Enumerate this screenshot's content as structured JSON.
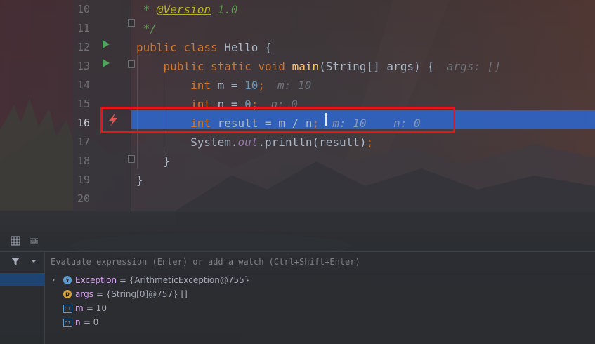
{
  "editor": {
    "lines": [
      {
        "num": "10",
        "parts": [
          {
            "t": " * ",
            "c": "cm"
          },
          {
            "t": "@Version",
            "c": "ann"
          },
          {
            "t": " 1.0",
            "c": "cm"
          }
        ]
      },
      {
        "num": "11",
        "parts": [
          {
            "t": " */",
            "c": "cm"
          }
        ]
      },
      {
        "num": "12",
        "parts": [
          {
            "t": "public class ",
            "c": "kw"
          },
          {
            "t": "Hello {",
            "c": ""
          }
        ]
      },
      {
        "num": "13",
        "parts": [
          {
            "t": "    public static void ",
            "c": "kw"
          },
          {
            "t": "main",
            "c": "fn"
          },
          {
            "t": "(String[] args) {",
            "c": ""
          },
          {
            "t": "args: []",
            "c": "hint"
          }
        ]
      },
      {
        "num": "14",
        "parts": [
          {
            "t": "        int ",
            "c": "kw"
          },
          {
            "t": "m = ",
            "c": ""
          },
          {
            "t": "10",
            "c": "num"
          },
          {
            "t": ";",
            "c": "kw"
          },
          {
            "t": "m: 10",
            "c": "hint"
          }
        ]
      },
      {
        "num": "15",
        "parts": [
          {
            "t": "        int ",
            "c": "kw"
          },
          {
            "t": "n = ",
            "c": ""
          },
          {
            "t": "0",
            "c": "num"
          },
          {
            "t": ";",
            "c": "kw"
          },
          {
            "t": "n: 0",
            "c": "hint"
          }
        ]
      },
      {
        "num": "16",
        "parts": [
          {
            "t": "        int ",
            "c": "kw"
          },
          {
            "t": "result = m / n",
            "c": ""
          },
          {
            "t": ";",
            "c": "kw"
          },
          {
            "t": "  m: 10    n: 0",
            "c": "hint2"
          }
        ]
      },
      {
        "num": "17",
        "parts": [
          {
            "t": "        System.",
            "c": ""
          },
          {
            "t": "out",
            "c": "fld"
          },
          {
            "t": ".println(result)",
            "c": ""
          },
          {
            "t": ";",
            "c": "kw"
          }
        ]
      },
      {
        "num": "18",
        "parts": [
          {
            "t": "    }",
            "c": ""
          }
        ]
      },
      {
        "num": "19",
        "parts": [
          {
            "t": "}",
            "c": ""
          }
        ]
      },
      {
        "num": "20",
        "parts": []
      }
    ],
    "current_line": "16"
  },
  "debugger": {
    "toolbar": {
      "grid_icon": "table-icon",
      "watch_icon": "watches-icon"
    },
    "side": {
      "filter_icon": "filter-icon",
      "dropdown_icon": "chevron-down-icon"
    },
    "eval_placeholder": "Evaluate expression (Enter) or add a watch (Ctrl+Shift+Enter)",
    "variables": [
      {
        "name": "Exception",
        "value": " = {ArithmeticException@755}",
        "icon": "exception-icon",
        "expandable": true
      },
      {
        "name": "args",
        "value": " = {String[0]@757} []",
        "icon": "param-icon",
        "expandable": false
      },
      {
        "name": "m",
        "value": " = 10",
        "icon": "local-var-icon",
        "expandable": false
      },
      {
        "name": "n",
        "value": " = 0",
        "icon": "local-var-icon",
        "expandable": false
      }
    ]
  },
  "colors": {
    "execution_line": "#2f65ca",
    "highlight_box": "#e3161c",
    "keyword": "#cc7832"
  }
}
